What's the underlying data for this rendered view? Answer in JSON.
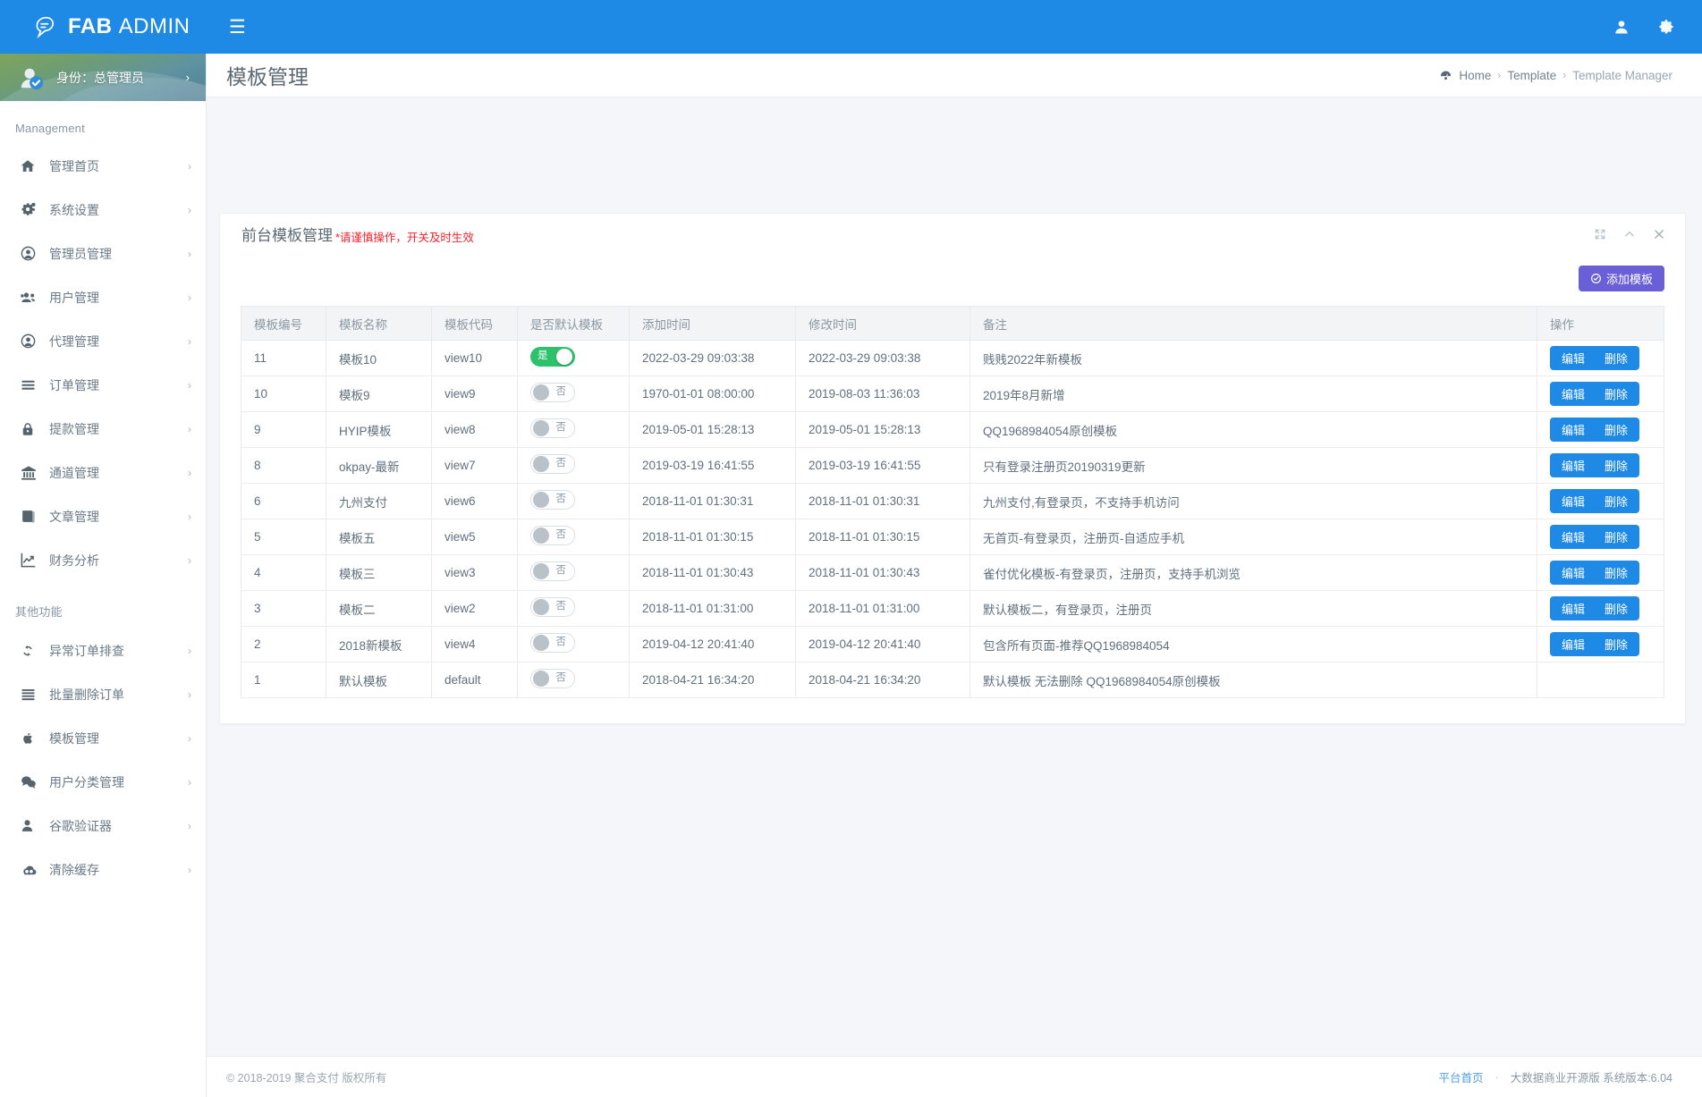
{
  "brand": {
    "bold": "FAB",
    "light": "ADMIN",
    "logo_icon": "fab-logo-icon"
  },
  "topbar": {
    "menu_toggle_icon": "hamburger-icon",
    "user_icon": "user-icon",
    "settings_icon": "gear-icon"
  },
  "sidebar": {
    "user_panel": {
      "label": "身份：总管理员",
      "chevron": "›",
      "avatar_icon": "avatar-verified-icon"
    },
    "sections": [
      {
        "heading": "Management",
        "items": [
          {
            "label": "管理首页",
            "icon": "home-icon",
            "chevron": "›"
          },
          {
            "label": "系统设置",
            "icon": "gears-icon",
            "chevron": "›"
          },
          {
            "label": "管理员管理",
            "icon": "user-circle-icon",
            "chevron": "›"
          },
          {
            "label": "用户管理",
            "icon": "users-icon",
            "chevron": "›"
          },
          {
            "label": "代理管理",
            "icon": "user-circle-icon",
            "chevron": "›"
          },
          {
            "label": "订单管理",
            "icon": "list-icon",
            "chevron": "›"
          },
          {
            "label": "提款管理",
            "icon": "lock-icon",
            "chevron": "›"
          },
          {
            "label": "通道管理",
            "icon": "bank-icon",
            "chevron": "›"
          },
          {
            "label": "文章管理",
            "icon": "book-icon",
            "chevron": "›"
          },
          {
            "label": "财务分析",
            "icon": "chart-line-icon",
            "chevron": "›"
          }
        ]
      },
      {
        "heading": "其他功能",
        "items": [
          {
            "label": "异常订单排查",
            "icon": "refresh-icon",
            "chevron": "›"
          },
          {
            "label": "批量删除订单",
            "icon": "list-icon",
            "chevron": "›"
          },
          {
            "label": "模板管理",
            "icon": "apple-icon",
            "chevron": "›"
          },
          {
            "label": "用户分类管理",
            "icon": "comments-icon",
            "chevron": "›"
          },
          {
            "label": "谷歌验证器",
            "icon": "user-solid-icon",
            "chevron": "›"
          },
          {
            "label": "清除缓存",
            "icon": "cloud-icon",
            "chevron": "›"
          }
        ]
      }
    ]
  },
  "page": {
    "title": "模板管理",
    "breadcrumb": {
      "home_icon": "dashboard-icon",
      "home": "Home",
      "sep1": "›",
      "template": "Template",
      "sep2": "›",
      "current": "Template Manager"
    }
  },
  "card": {
    "title": "前台模板管理",
    "warning": "*请谨慎操作，开关及时生效",
    "tools": {
      "expand_icon": "expand-icon",
      "collapse_icon": "chevron-up-icon",
      "close_icon": "close-icon"
    },
    "add_button": {
      "label": "添加模板",
      "icon": "check-circle-icon",
      "color": "#6a5fd6"
    }
  },
  "table": {
    "headers": [
      "模板编号",
      "模板名称",
      "模板代码",
      "是否默认模板",
      "添加时间",
      "修改时间",
      "备注",
      "操作"
    ],
    "switch_labels": {
      "on": "是",
      "off": "否"
    },
    "action_labels": {
      "edit": "编辑",
      "delete": "删除"
    },
    "rows": [
      {
        "id": "11",
        "name": "模板10",
        "code": "view10",
        "is_default": true,
        "added": "2022-03-29 09:03:38",
        "modified": "2022-03-29 09:03:38",
        "remark": "贱贱2022年新模板",
        "has_actions": true
      },
      {
        "id": "10",
        "name": "模板9",
        "code": "view9",
        "is_default": false,
        "added": "1970-01-01 08:00:00",
        "modified": "2019-08-03 11:36:03",
        "remark": "2019年8月新增",
        "has_actions": true
      },
      {
        "id": "9",
        "name": "HYIP模板",
        "code": "view8",
        "is_default": false,
        "added": "2019-05-01 15:28:13",
        "modified": "2019-05-01 15:28:13",
        "remark": "QQ1968984054原创模板",
        "has_actions": true
      },
      {
        "id": "8",
        "name": "okpay-最新",
        "code": "view7",
        "is_default": false,
        "added": "2019-03-19 16:41:55",
        "modified": "2019-03-19 16:41:55",
        "remark": "只有登录注册页20190319更新",
        "has_actions": true
      },
      {
        "id": "6",
        "name": "九州支付",
        "code": "view6",
        "is_default": false,
        "added": "2018-11-01 01:30:31",
        "modified": "2018-11-01 01:30:31",
        "remark": "九州支付,有登录页，不支持手机访问",
        "has_actions": true
      },
      {
        "id": "5",
        "name": "模板五",
        "code": "view5",
        "is_default": false,
        "added": "2018-11-01 01:30:15",
        "modified": "2018-11-01 01:30:15",
        "remark": "无首页-有登录页，注册页-自适应手机",
        "has_actions": true
      },
      {
        "id": "4",
        "name": "模板三",
        "code": "view3",
        "is_default": false,
        "added": "2018-11-01 01:30:43",
        "modified": "2018-11-01 01:30:43",
        "remark": "雀付优化模板-有登录页，注册页，支持手机浏览",
        "has_actions": true
      },
      {
        "id": "3",
        "name": "模板二",
        "code": "view2",
        "is_default": false,
        "added": "2018-11-01 01:31:00",
        "modified": "2018-11-01 01:31:00",
        "remark": "默认模板二，有登录页，注册页",
        "has_actions": true
      },
      {
        "id": "2",
        "name": "2018新模板",
        "code": "view4",
        "is_default": false,
        "added": "2019-04-12 20:41:40",
        "modified": "2019-04-12 20:41:40",
        "remark": "包含所有页面-推荐QQ1968984054",
        "has_actions": true
      },
      {
        "id": "1",
        "name": "默认模板",
        "code": "default",
        "is_default": false,
        "added": "2018-04-21 16:34:20",
        "modified": "2018-04-21 16:34:20",
        "remark": "默认模板 无法删除 QQ1968984054原创模板",
        "has_actions": false
      }
    ]
  },
  "footer": {
    "copyright": "© 2018-2019 聚合支付 版权所有",
    "link": "平台首页",
    "dot": "·",
    "version": "大数据商业开源版 系统版本:6.04"
  },
  "colors": {
    "topbar": "#1e8ae5",
    "primary_button": "#1e8ae5",
    "add_button": "#6a5fd6",
    "switch_on": "#2ec16b",
    "warning_text": "#f5222d"
  }
}
